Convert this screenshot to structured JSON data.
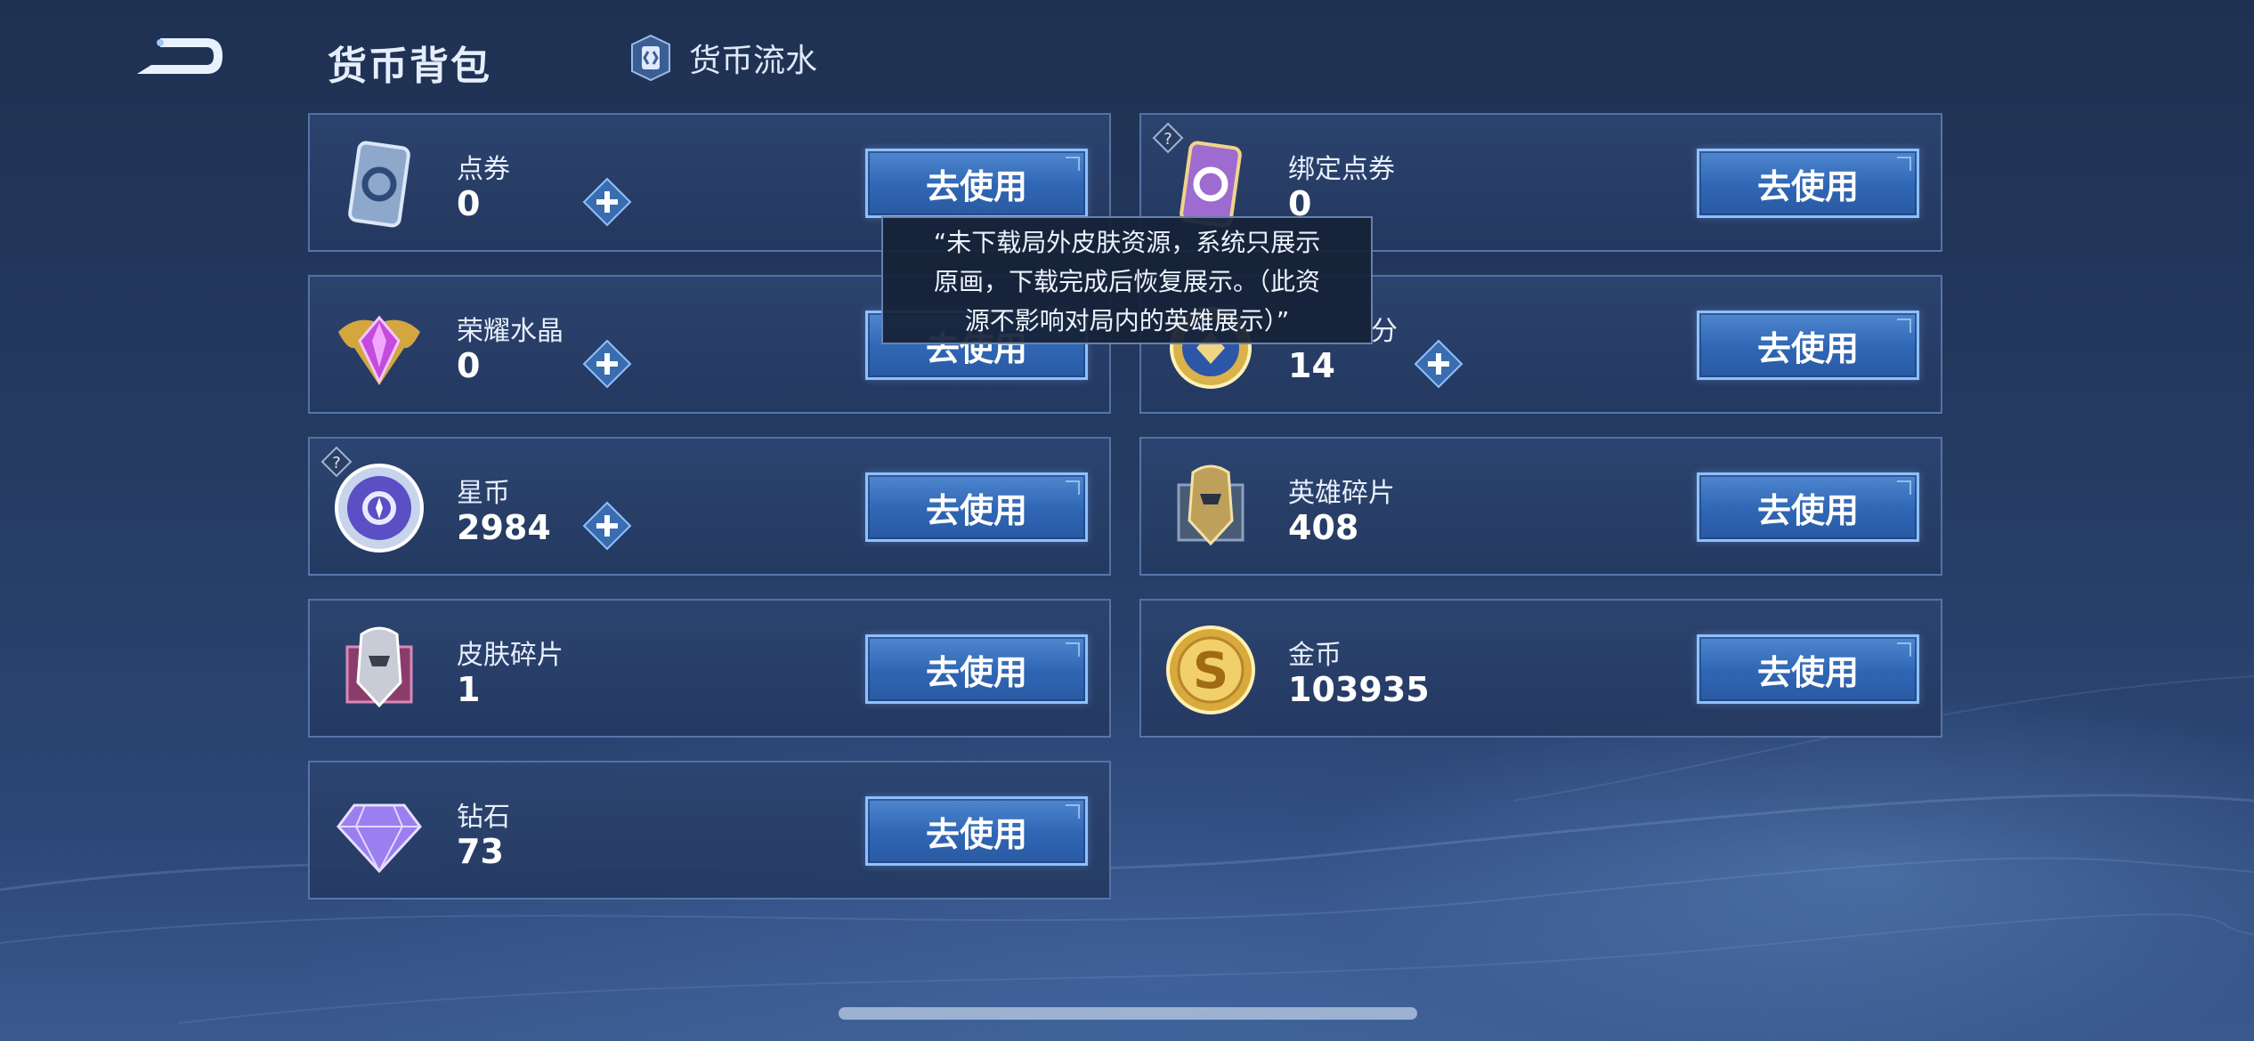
{
  "header": {
    "title": "货币背包",
    "flow_label": "货币流水",
    "back_icon": "back-arrow-icon",
    "flow_icon": "ledger-card-icon"
  },
  "currencies": [
    {
      "name": "点券",
      "amount": "0",
      "button": "去使用",
      "icon": "voucher-card-icon",
      "has_plus": true,
      "has_help": false
    },
    {
      "name": "绑定点券",
      "amount": "0",
      "button": "去使用",
      "icon": "bound-voucher-card-icon",
      "has_plus": false,
      "has_help": true
    },
    {
      "name": "荣耀水晶",
      "amount": "0",
      "button": "去使用",
      "icon": "glory-crystal-icon",
      "has_plus": true,
      "has_help": false
    },
    {
      "name": "分",
      "amount": "14",
      "button": "去使用",
      "icon": "points-badge-icon",
      "has_plus": true,
      "has_help": false
    },
    {
      "name": "星币",
      "amount": "2984",
      "button": "去使用",
      "icon": "star-coin-icon",
      "has_plus": true,
      "has_help": true
    },
    {
      "name": "英雄碎片",
      "amount": "408",
      "button": "去使用",
      "icon": "hero-fragment-icon",
      "has_plus": false,
      "has_help": false
    },
    {
      "name": "皮肤碎片",
      "amount": "1",
      "button": "去使用",
      "icon": "skin-fragment-icon",
      "has_plus": false,
      "has_help": false
    },
    {
      "name": "金币",
      "amount": "103935",
      "button": "去使用",
      "icon": "gold-coin-icon",
      "has_plus": false,
      "has_help": false
    },
    {
      "name": "钻石",
      "amount": "73",
      "button": "去使用",
      "icon": "diamond-icon",
      "has_plus": false,
      "has_help": false
    }
  ],
  "tooltip": {
    "line1": "“未下载局外皮肤资源，系统只展示",
    "line2": "原画，下载完成后恢复展示。（此资",
    "line3": "源不影响对局内的英雄展示）”"
  },
  "colors": {
    "button_fill": "#3a74c4",
    "button_border": "#8fc0ff",
    "card_border": "#78a0dc",
    "background": "#253b62"
  }
}
